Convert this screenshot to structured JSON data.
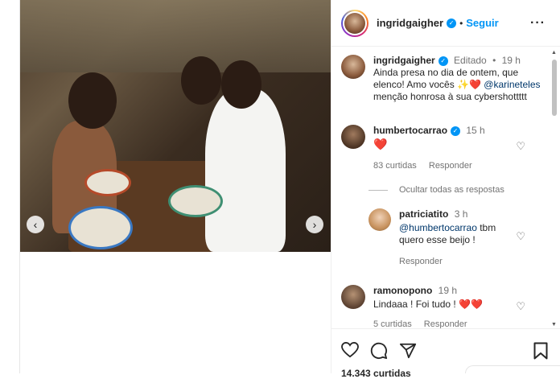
{
  "post": {
    "author": "ingridgaigher",
    "follow_label": "Seguir",
    "caption": {
      "username": "ingridgaigher",
      "edited": "Editado",
      "time": "19 h",
      "text_1": "Ainda presa no dia de ontem, que elenco! Amo vocês ",
      "emojis": "✨❤️",
      "mention": "@karineteles",
      "text_2": "menção honrosa à sua cybershottttt"
    },
    "likes_text": "14.343 curtidas"
  },
  "comments": [
    {
      "username": "humbertocarrao",
      "time": "15 h",
      "text": "❤️",
      "likes": "83 curtidas",
      "reply_label": "Responder"
    },
    {
      "username": "patriciatito",
      "time": "3 h",
      "mention": "@humbertocarrao",
      "text_a": " tbm",
      "text_b": "quero esse beijo !",
      "reply_label": "Responder"
    },
    {
      "username": "ramonopono",
      "time": "19 h",
      "text": "Lindaaa ! Foi tudo ! ",
      "emojis": "❤️❤️",
      "likes": "5 curtidas",
      "reply_label": "Responder"
    }
  ],
  "hide_replies_label": "Ocultar todas as respostas",
  "icons": {
    "prev": "chevron-left-icon",
    "next": "chevron-right-icon",
    "more": "more-options-icon",
    "heart": "heart-icon",
    "comment": "comment-icon",
    "share": "share-icon",
    "save": "bookmark-icon"
  },
  "colors": {
    "accent": "#0095f6",
    "verified": "#0095f6",
    "heart": "#e0245e"
  }
}
